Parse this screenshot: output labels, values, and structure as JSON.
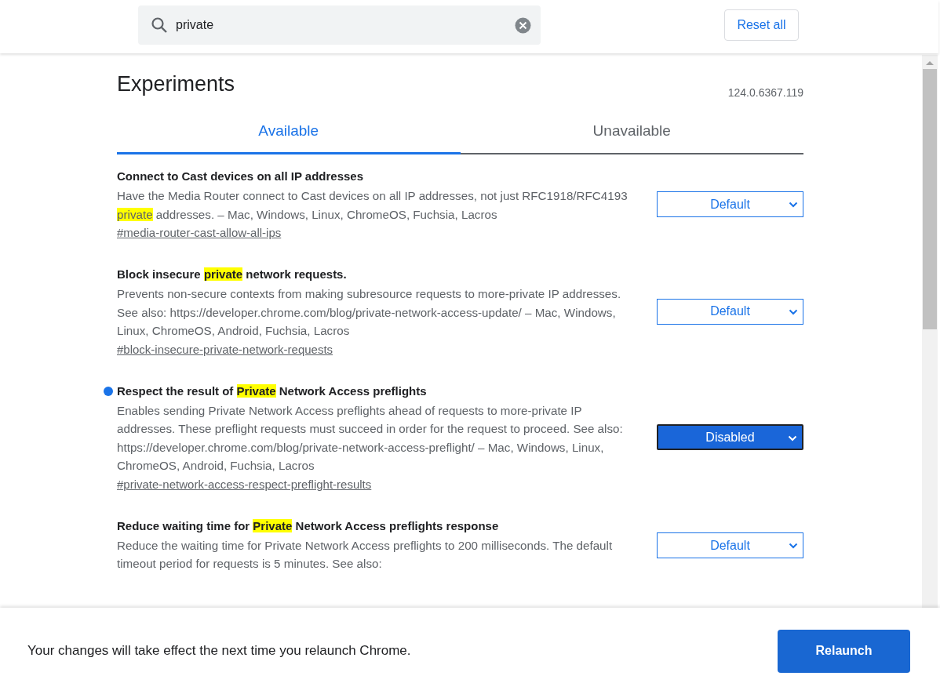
{
  "search": {
    "value": "private"
  },
  "reset_button": "Reset all",
  "title": "Experiments",
  "version": "124.0.6367.119",
  "tabs": [
    {
      "label": "Available",
      "selected": true
    },
    {
      "label": "Unavailable",
      "selected": false
    }
  ],
  "experiments": [
    {
      "modified": false,
      "title": [
        {
          "text": "Connect to Cast devices on all IP addresses",
          "highlight": false
        }
      ],
      "description": [
        {
          "text": "Have the Media Router connect to Cast devices on all IP addresses, not just RFC1918/RFC4193 ",
          "highlight": false
        },
        {
          "text": "private",
          "highlight": true
        },
        {
          "text": " addresses. – Mac, Windows, Linux, ChromeOS, Fuchsia, Lacros",
          "highlight": false
        }
      ],
      "link": "#media-router-cast-allow-all-ips",
      "select": "Default"
    },
    {
      "modified": false,
      "title": [
        {
          "text": "Block insecure ",
          "highlight": false
        },
        {
          "text": "private",
          "highlight": true
        },
        {
          "text": " network requests.",
          "highlight": false
        }
      ],
      "description": [
        {
          "text": "Prevents non-secure contexts from making subresource requests to more-private IP addresses. See also: https://developer.chrome.com/blog/private-network-access-update/ – Mac, Windows, Linux, ChromeOS, Android, Fuchsia, Lacros",
          "highlight": false
        }
      ],
      "link": "#block-insecure-private-network-requests",
      "select": "Default"
    },
    {
      "modified": true,
      "title": [
        {
          "text": "Respect the result of ",
          "highlight": false
        },
        {
          "text": "Private",
          "highlight": true
        },
        {
          "text": " Network Access preflights",
          "highlight": false
        }
      ],
      "description": [
        {
          "text": "Enables sending Private Network Access preflights ahead of requests to more-private IP addresses. These preflight requests must succeed in order for the request to proceed. See also: https://developer.chrome.com/blog/private-network-access-preflight/ – Mac, Windows, Linux, ChromeOS, Android, Fuchsia, Lacros",
          "highlight": false
        }
      ],
      "link": "#private-network-access-respect-preflight-results",
      "select": "Disabled"
    },
    {
      "modified": false,
      "title": [
        {
          "text": "Reduce waiting time for ",
          "highlight": false
        },
        {
          "text": "Private",
          "highlight": true
        },
        {
          "text": " Network Access preflights response",
          "highlight": false
        }
      ],
      "description": [
        {
          "text": "Reduce the waiting time for Private Network Access preflights to 200 milliseconds. The default timeout period for requests is 5 minutes. See also:",
          "highlight": false
        }
      ],
      "select": "Default"
    }
  ],
  "footer": {
    "message": "Your changes will take effect the next time you relaunch Chrome.",
    "button": "Relaunch"
  }
}
